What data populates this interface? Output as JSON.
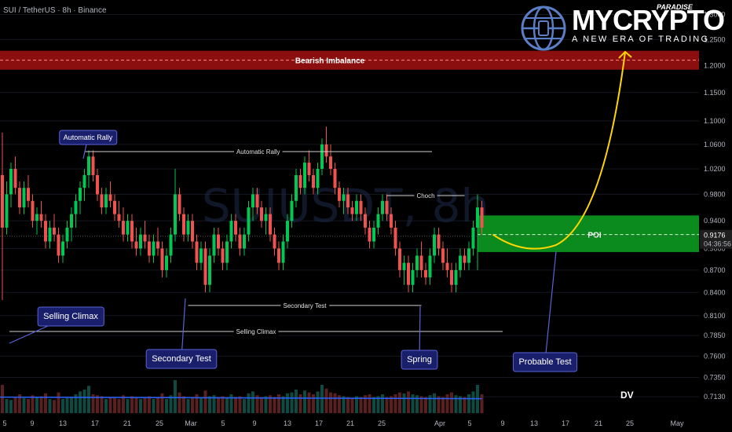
{
  "header": {
    "symbol_line": "SUI / TetherUS · 8h · Binance"
  },
  "brand": {
    "name": "MYCRYPTO",
    "superscript": "PARADISE",
    "tagline": "A NEW ERA OF TRADING"
  },
  "watermark": "SUIUSDT, 8h",
  "footer_mark": "DV",
  "colors": {
    "up": "#26a69a",
    "up_bright": "#00c853",
    "down": "#ef5350",
    "bearish_zone": "#8b0f0f",
    "poi_zone": "#0b8a1e",
    "curve": "#ffd600",
    "label_bg": "#1a1f6b",
    "label_border": "#5a63d8",
    "volume_ma": "#2962ff"
  },
  "chart_data": {
    "type": "candlestick",
    "title": "SUI / TetherUS · 8h · Binance",
    "y_axis": {
      "scale": "log",
      "ylim": [
        0.7,
        1.33
      ],
      "ticks": [
        "1.3000",
        "1.2500",
        "1.2000",
        "1.1500",
        "1.1000",
        "1.0600",
        "1.0200",
        "0.9800",
        "0.9400",
        "0.9000",
        "0.8700",
        "0.8400",
        "0.8100",
        "0.7850",
        "0.7600",
        "0.7350",
        "0.7130"
      ]
    },
    "x_axis": {
      "ticks": [
        "5",
        "9",
        "13",
        "17",
        "21",
        "25",
        "Mar",
        "5",
        "9",
        "13",
        "17",
        "21",
        "25",
        "Apr",
        "5",
        "9",
        "13",
        "17",
        "21",
        "25",
        "May"
      ]
    },
    "current_price": {
      "price": "0.9176",
      "countdown": "04:36:56",
      "value": 0.9176
    },
    "zones": [
      {
        "name": "Bearish Imbalance",
        "low": 1.192,
        "high": 1.228,
        "mid": 1.21
      },
      {
        "name": "POI",
        "low": 0.895,
        "high": 0.948,
        "mid": 0.92
      }
    ],
    "levels": [
      {
        "name": "Automatic Rally",
        "price": 1.048
      },
      {
        "name": "Choch",
        "price": 0.978
      },
      {
        "name": "Secondary Test",
        "price": 0.823
      },
      {
        "name": "Selling Climax",
        "price": 0.79
      }
    ],
    "callouts": [
      "Automatic Rally",
      "Selling Climax",
      "Secondary Test",
      "Spring",
      "Probable Test"
    ],
    "candles": [
      [
        1.01,
        1.08,
        0.83,
        0.93
      ],
      [
        0.93,
        1.0,
        0.92,
        0.98
      ],
      [
        0.98,
        1.03,
        0.96,
        1.02
      ],
      [
        1.02,
        1.04,
        0.98,
        0.99
      ],
      [
        0.99,
        1.0,
        0.95,
        0.96
      ],
      [
        0.96,
        1.0,
        0.95,
        0.99
      ],
      [
        0.99,
        1.01,
        0.96,
        0.97
      ],
      [
        0.97,
        0.98,
        0.93,
        0.94
      ],
      [
        0.94,
        0.96,
        0.92,
        0.95
      ],
      [
        0.95,
        0.97,
        0.93,
        0.94
      ],
      [
        0.94,
        0.95,
        0.9,
        0.91
      ],
      [
        0.91,
        0.94,
        0.9,
        0.93
      ],
      [
        0.93,
        0.95,
        0.91,
        0.92
      ],
      [
        0.92,
        0.93,
        0.88,
        0.89
      ],
      [
        0.89,
        0.92,
        0.88,
        0.91
      ],
      [
        0.91,
        0.94,
        0.9,
        0.93
      ],
      [
        0.93,
        0.96,
        0.91,
        0.95
      ],
      [
        0.95,
        0.98,
        0.93,
        0.97
      ],
      [
        0.97,
        1.0,
        0.95,
        0.99
      ],
      [
        0.99,
        1.02,
        0.97,
        1.01
      ],
      [
        1.01,
        1.05,
        0.99,
        1.04
      ],
      [
        1.04,
        1.05,
        1.0,
        1.01
      ],
      [
        1.01,
        1.02,
        0.97,
        0.98
      ],
      [
        0.98,
        0.99,
        0.95,
        0.96
      ],
      [
        0.96,
        0.99,
        0.95,
        0.98
      ],
      [
        0.98,
        1.0,
        0.96,
        0.97
      ],
      [
        0.97,
        0.98,
        0.94,
        0.95
      ],
      [
        0.95,
        0.97,
        0.93,
        0.94
      ],
      [
        0.94,
        0.96,
        0.91,
        0.92
      ],
      [
        0.92,
        0.95,
        0.91,
        0.94
      ],
      [
        0.94,
        0.95,
        0.9,
        0.91
      ],
      [
        0.91,
        0.93,
        0.89,
        0.9
      ],
      [
        0.9,
        0.93,
        0.89,
        0.92
      ],
      [
        0.92,
        0.94,
        0.9,
        0.91
      ],
      [
        0.91,
        0.92,
        0.88,
        0.89
      ],
      [
        0.89,
        0.92,
        0.88,
        0.91
      ],
      [
        0.91,
        0.93,
        0.89,
        0.9
      ],
      [
        0.9,
        0.91,
        0.86,
        0.87
      ],
      [
        0.87,
        0.9,
        0.86,
        0.89
      ],
      [
        0.89,
        0.93,
        0.88,
        0.92
      ],
      [
        0.92,
        1.02,
        0.91,
        0.98
      ],
      [
        0.98,
        0.99,
        0.94,
        0.95
      ],
      [
        0.95,
        0.96,
        0.91,
        0.92
      ],
      [
        0.92,
        0.95,
        0.91,
        0.94
      ],
      [
        0.94,
        0.95,
        0.9,
        0.91
      ],
      [
        0.91,
        0.92,
        0.87,
        0.88
      ],
      [
        0.88,
        0.91,
        0.87,
        0.9
      ],
      [
        0.9,
        0.91,
        0.84,
        0.85
      ],
      [
        0.85,
        0.9,
        0.84,
        0.89
      ],
      [
        0.89,
        0.93,
        0.88,
        0.92
      ],
      [
        0.92,
        0.93,
        0.89,
        0.9
      ],
      [
        0.9,
        0.91,
        0.87,
        0.88
      ],
      [
        0.88,
        0.92,
        0.87,
        0.91
      ],
      [
        0.91,
        0.95,
        0.9,
        0.94
      ],
      [
        0.94,
        0.95,
        0.91,
        0.92
      ],
      [
        0.92,
        0.93,
        0.89,
        0.9
      ],
      [
        0.9,
        0.93,
        0.89,
        0.92
      ],
      [
        0.92,
        0.97,
        0.91,
        0.96
      ],
      [
        0.96,
        0.99,
        0.94,
        0.98
      ],
      [
        0.98,
        0.99,
        0.95,
        0.96
      ],
      [
        0.96,
        0.97,
        0.93,
        0.94
      ],
      [
        0.94,
        0.96,
        0.92,
        0.95
      ],
      [
        0.95,
        0.96,
        0.91,
        0.92
      ],
      [
        0.92,
        0.93,
        0.89,
        0.9
      ],
      [
        0.9,
        0.91,
        0.87,
        0.88
      ],
      [
        0.88,
        0.92,
        0.87,
        0.91
      ],
      [
        0.91,
        0.95,
        0.9,
        0.94
      ],
      [
        0.94,
        0.98,
        0.93,
        0.97
      ],
      [
        0.97,
        1.02,
        0.96,
        1.01
      ],
      [
        1.01,
        1.02,
        0.98,
        0.99
      ],
      [
        0.99,
        1.04,
        0.98,
        1.03
      ],
      [
        1.03,
        1.05,
        1.0,
        1.01
      ],
      [
        1.01,
        1.02,
        0.98,
        0.99
      ],
      [
        0.99,
        1.03,
        0.98,
        1.02
      ],
      [
        1.02,
        1.07,
        1.01,
        1.06
      ],
      [
        1.06,
        1.09,
        1.03,
        1.04
      ],
      [
        1.04,
        1.06,
        1.01,
        1.02
      ],
      [
        1.02,
        1.03,
        0.98,
        0.99
      ],
      [
        0.99,
        1.0,
        0.96,
        0.97
      ],
      [
        0.97,
        0.99,
        0.95,
        0.98
      ],
      [
        0.98,
        0.99,
        0.95,
        0.96
      ],
      [
        0.96,
        0.97,
        0.94,
        0.95
      ],
      [
        0.95,
        0.98,
        0.94,
        0.97
      ],
      [
        0.97,
        0.98,
        0.94,
        0.95
      ],
      [
        0.95,
        0.96,
        0.92,
        0.93
      ],
      [
        0.93,
        0.94,
        0.9,
        0.91
      ],
      [
        0.91,
        0.94,
        0.9,
        0.93
      ],
      [
        0.93,
        0.96,
        0.92,
        0.95
      ],
      [
        0.95,
        0.98,
        0.94,
        0.97
      ],
      [
        0.97,
        0.98,
        0.94,
        0.95
      ],
      [
        0.95,
        0.96,
        0.92,
        0.93
      ],
      [
        0.93,
        0.94,
        0.89,
        0.9
      ],
      [
        0.9,
        0.91,
        0.86,
        0.87
      ],
      [
        0.87,
        0.89,
        0.85,
        0.88
      ],
      [
        0.88,
        0.89,
        0.84,
        0.85
      ],
      [
        0.85,
        0.88,
        0.84,
        0.87
      ],
      [
        0.87,
        0.9,
        0.86,
        0.89
      ],
      [
        0.89,
        0.91,
        0.86,
        0.87
      ],
      [
        0.87,
        0.88,
        0.85,
        0.86
      ],
      [
        0.86,
        0.9,
        0.85,
        0.89
      ],
      [
        0.89,
        0.93,
        0.88,
        0.92
      ],
      [
        0.92,
        0.93,
        0.89,
        0.9
      ],
      [
        0.9,
        0.91,
        0.87,
        0.88
      ],
      [
        0.88,
        0.9,
        0.86,
        0.87
      ],
      [
        0.87,
        0.88,
        0.84,
        0.85
      ],
      [
        0.85,
        0.88,
        0.84,
        0.87
      ],
      [
        0.87,
        0.9,
        0.86,
        0.89
      ],
      [
        0.89,
        0.9,
        0.87,
        0.88
      ],
      [
        0.88,
        0.91,
        0.87,
        0.9
      ],
      [
        0.9,
        0.94,
        0.89,
        0.93
      ],
      [
        0.93,
        0.98,
        0.87,
        0.96
      ],
      [
        0.96,
        0.97,
        0.92,
        0.93
      ]
    ],
    "volume": [
      60,
      30,
      28,
      35,
      40,
      32,
      30,
      38,
      34,
      36,
      42,
      30,
      28,
      44,
      30,
      32,
      35,
      40,
      46,
      50,
      58,
      40,
      38,
      36,
      30,
      34,
      32,
      30,
      38,
      30,
      36,
      34,
      30,
      32,
      36,
      30,
      34,
      42,
      30,
      38,
      70,
      44,
      36,
      30,
      34,
      40,
      32,
      48,
      36,
      38,
      34,
      36,
      32,
      40,
      34,
      36,
      30,
      42,
      46,
      38,
      34,
      36,
      38,
      34,
      40,
      36,
      42,
      44,
      50,
      40,
      48,
      44,
      40,
      46,
      60,
      52,
      44,
      42,
      38,
      36,
      34,
      32,
      36,
      34,
      38,
      40,
      34,
      36,
      40,
      34,
      36,
      40,
      44,
      42,
      46,
      40,
      38,
      36,
      34,
      38,
      42,
      36,
      34,
      40,
      44,
      38,
      36,
      34,
      40,
      46,
      60,
      40
    ],
    "volume_ma": 34,
    "projection": {
      "from_price": 0.92,
      "min_price": 0.905,
      "to_price": 1.22,
      "label": ""
    }
  }
}
